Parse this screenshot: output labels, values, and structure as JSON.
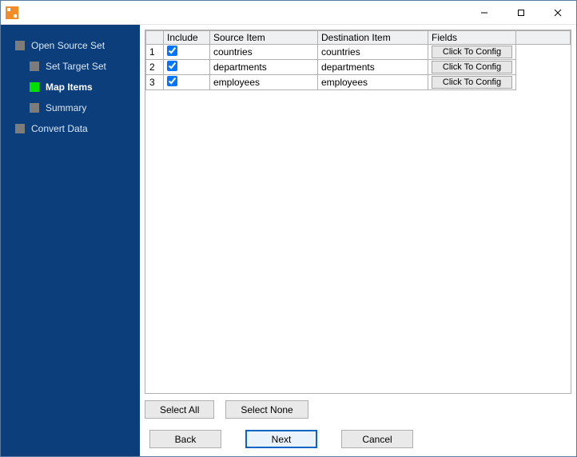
{
  "window": {
    "title": ""
  },
  "sidebar": {
    "items": [
      {
        "label": "Open Source Set",
        "active": false,
        "children": [
          {
            "label": "Set Target Set",
            "active": false
          },
          {
            "label": "Map Items",
            "active": true
          },
          {
            "label": "Summary",
            "active": false
          }
        ]
      },
      {
        "label": "Convert Data",
        "active": false
      }
    ]
  },
  "grid": {
    "headers": {
      "rownum": "",
      "include": "Include",
      "source": "Source Item",
      "destination": "Destination Item",
      "fields": "Fields"
    },
    "config_button_label": "Click To Config",
    "rows": [
      {
        "n": "1",
        "include": true,
        "source": "countries",
        "destination": "countries"
      },
      {
        "n": "2",
        "include": true,
        "source": "departments",
        "destination": "departments"
      },
      {
        "n": "3",
        "include": true,
        "source": "employees",
        "destination": "employees"
      }
    ]
  },
  "buttons": {
    "select_all": "Select All",
    "select_none": "Select None",
    "back": "Back",
    "next": "Next",
    "cancel": "Cancel"
  }
}
